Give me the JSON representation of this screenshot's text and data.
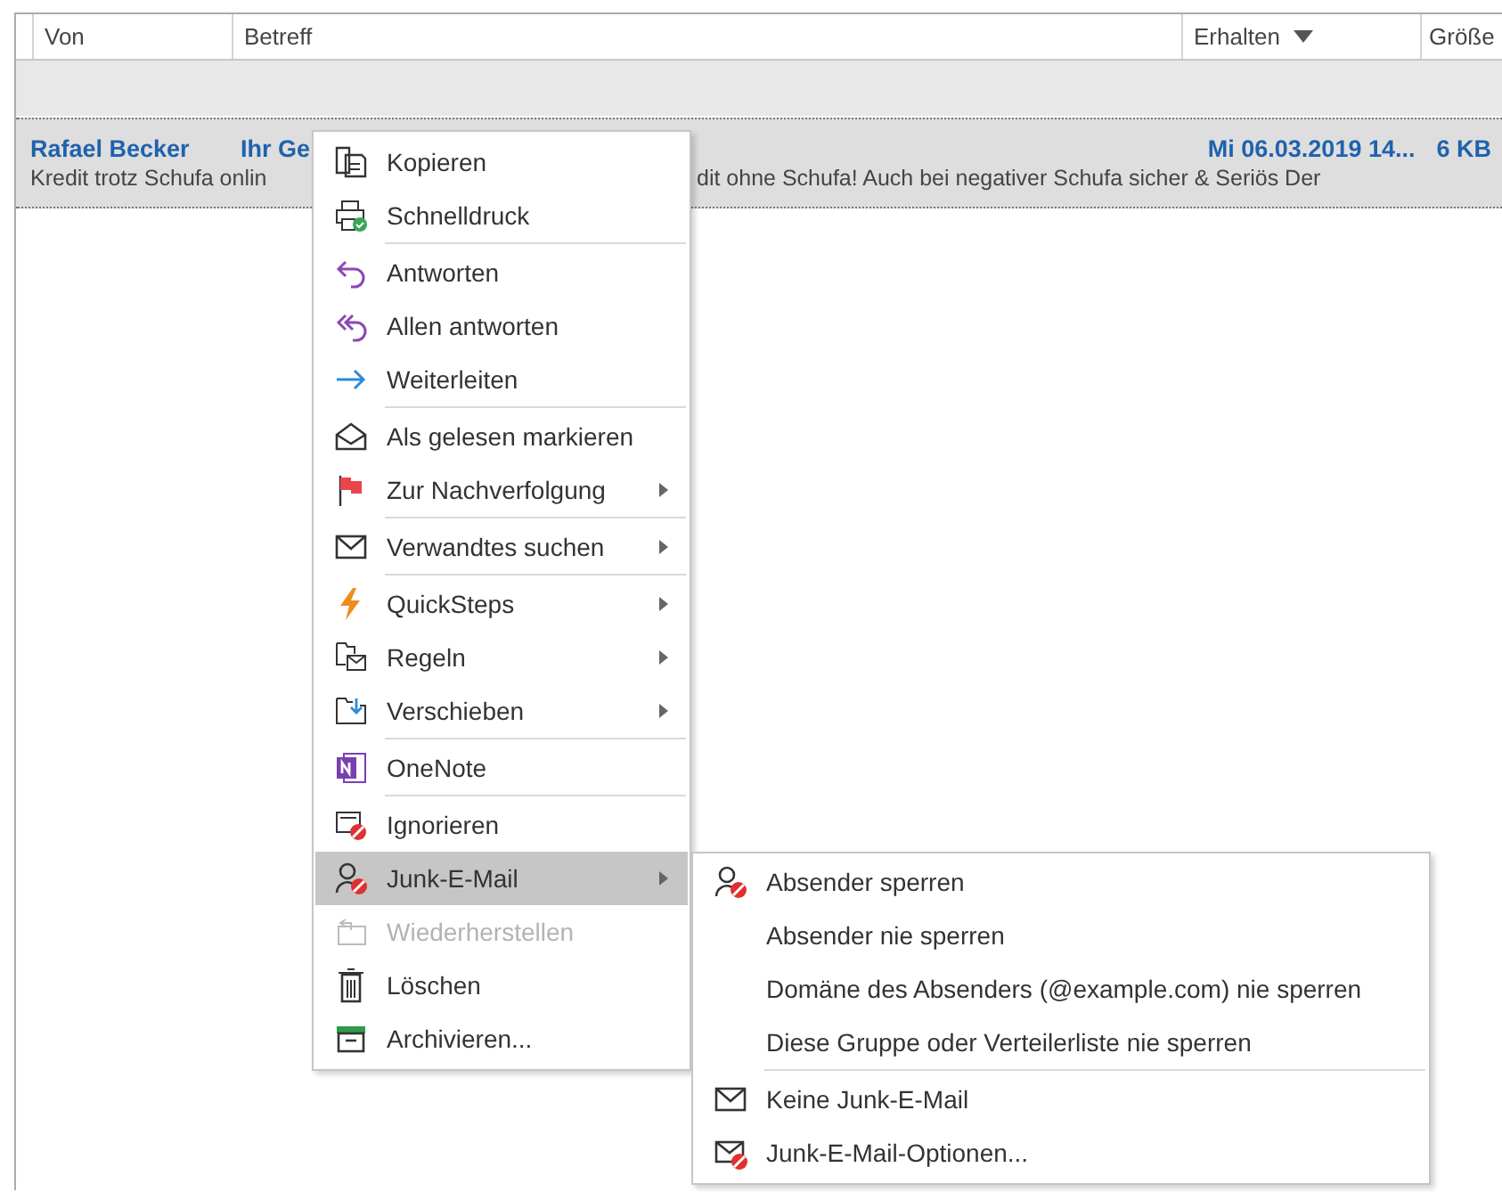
{
  "columns": [
    {
      "label": "Von"
    },
    {
      "label": "Betreff"
    },
    {
      "label": "Erhalten",
      "sorted": true
    },
    {
      "label": "Größe"
    }
  ],
  "message": {
    "sender": "Rafael Becker",
    "subject": "Ihr Ge",
    "received": "Mi 06.03.2019 14...",
    "size": "6 KB",
    "preview_start": "Kredit trotz Schufa onlin",
    "preview_end": "dit ohne Schufa! Auch bei negativer Schufa sicher & Seriös   Der",
    "selected": true
  },
  "context_menu": [
    {
      "kind": "item",
      "label": "Kopieren",
      "submenu": false,
      "disabled": false,
      "selected": false
    },
    {
      "kind": "item",
      "label": "Schnelldruck",
      "submenu": false,
      "disabled": false,
      "selected": false
    },
    {
      "kind": "separator"
    },
    {
      "kind": "item",
      "label": "Antworten",
      "submenu": false,
      "disabled": false,
      "selected": false
    },
    {
      "kind": "item",
      "label": "Allen antworten",
      "submenu": false,
      "disabled": false,
      "selected": false
    },
    {
      "kind": "item",
      "label": "Weiterleiten",
      "submenu": false,
      "disabled": false,
      "selected": false
    },
    {
      "kind": "separator"
    },
    {
      "kind": "item",
      "label": "Als gelesen markieren",
      "submenu": false,
      "disabled": false,
      "selected": false
    },
    {
      "kind": "item",
      "label": "Zur Nachverfolgung",
      "submenu": true,
      "disabled": false,
      "selected": false
    },
    {
      "kind": "separator"
    },
    {
      "kind": "item",
      "label": "Verwandtes suchen",
      "submenu": true,
      "disabled": false,
      "selected": false
    },
    {
      "kind": "separator"
    },
    {
      "kind": "item",
      "label": "QuickSteps",
      "submenu": true,
      "disabled": false,
      "selected": false
    },
    {
      "kind": "item",
      "label": "Regeln",
      "submenu": true,
      "disabled": false,
      "selected": false
    },
    {
      "kind": "item",
      "label": "Verschieben",
      "submenu": true,
      "disabled": false,
      "selected": false
    },
    {
      "kind": "separator"
    },
    {
      "kind": "item",
      "label": "OneNote",
      "submenu": false,
      "disabled": false,
      "selected": false
    },
    {
      "kind": "separator"
    },
    {
      "kind": "item",
      "label": "Ignorieren",
      "submenu": false,
      "disabled": false,
      "selected": false
    },
    {
      "kind": "item",
      "label": "Junk-E-Mail",
      "submenu": true,
      "disabled": false,
      "selected": true
    },
    {
      "kind": "item",
      "label": "Wiederherstellen",
      "submenu": false,
      "disabled": true,
      "selected": false
    },
    {
      "kind": "item",
      "label": "Löschen",
      "submenu": false,
      "disabled": false,
      "selected": false
    },
    {
      "kind": "item",
      "label": "Archivieren...",
      "submenu": false,
      "disabled": false,
      "selected": false
    }
  ],
  "junk_submenu": [
    {
      "kind": "item",
      "label": "Absender sperren",
      "selected": false
    },
    {
      "kind": "item",
      "label": "Absender nie sperren",
      "selected": false
    },
    {
      "kind": "item",
      "label": "Domäne des Absenders (@example.com) nie sperren",
      "selected": false
    },
    {
      "kind": "item",
      "label": "Diese Gruppe oder Verteilerliste nie sperren",
      "selected": false
    },
    {
      "kind": "separator"
    },
    {
      "kind": "item",
      "label": "Keine Junk-E-Mail",
      "selected": false
    },
    {
      "kind": "item",
      "label": "Junk-E-Mail-Optionen...",
      "selected": false
    }
  ]
}
